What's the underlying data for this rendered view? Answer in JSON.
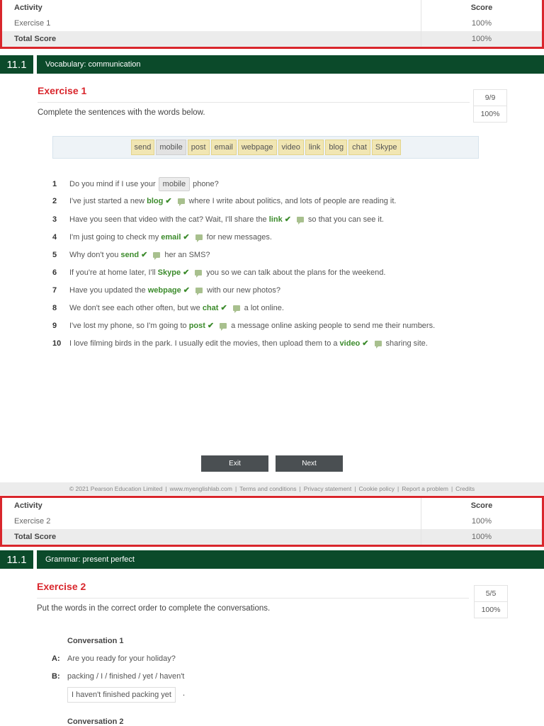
{
  "score_table_1": {
    "col_activity": "Activity",
    "col_score": "Score",
    "row_activity": "Exercise 1",
    "row_score": "100%",
    "total_label": "Total Score",
    "total_score": "100%"
  },
  "unit_1": {
    "number": "11.1",
    "title": "Vocabulary: communication"
  },
  "exercise_1": {
    "title": "Exercise 1",
    "instruction": "Complete the sentences with the words below.",
    "score_fraction": "9/9",
    "score_percent": "100%",
    "wordbank": [
      "send",
      "mobile",
      "post",
      "email",
      "webpage",
      "video",
      "link",
      "blog",
      "chat",
      "Skype"
    ],
    "sentences": [
      {
        "num": "1",
        "before": "Do you mind if I use your",
        "answer": "mobile",
        "after": "phone?"
      },
      {
        "num": "2",
        "before": "I've just started a new",
        "answer": "blog",
        "after": "where I write about politics, and lots of people are reading it."
      },
      {
        "num": "3",
        "before": "Have you seen that video with the cat? Wait, I'll share the",
        "answer": "link",
        "after": "so that you can see it."
      },
      {
        "num": "4",
        "before": "I'm just going to check my",
        "answer": "email",
        "after": "for new messages."
      },
      {
        "num": "5",
        "before": "Why don't you",
        "answer": "send",
        "after": "her an SMS?"
      },
      {
        "num": "6",
        "before": "If you're at home later, I'll",
        "answer": "Skype",
        "after": "you so we can talk about the plans for the weekend."
      },
      {
        "num": "7",
        "before": "Have you updated the",
        "answer": "webpage",
        "after": "with our new photos?"
      },
      {
        "num": "8",
        "before": "We don't see each other often, but we",
        "answer": "chat",
        "after": "a lot online."
      },
      {
        "num": "9",
        "before": "I've lost my phone, so I'm going to",
        "answer": "post",
        "after": "a message online asking people to send me their numbers."
      },
      {
        "num": "10",
        "before": "I love filming birds in the park. I usually edit the movies, then upload them to a",
        "answer": "video",
        "after": "sharing site."
      }
    ],
    "check_mark": "✔",
    "exit_label": "Exit",
    "next_label": "Next"
  },
  "footer": {
    "copyright": "© 2021 Pearson Education Limited",
    "links": [
      "www.myenglishlab.com",
      "Terms and conditions",
      "Privacy statement",
      "Cookie policy",
      "Report a problem",
      "Credits"
    ],
    "separator": "|"
  },
  "score_table_2": {
    "col_activity": "Activity",
    "col_score": "Score",
    "row_activity": "Exercise 2",
    "row_score": "100%",
    "total_label": "Total Score",
    "total_score": "100%"
  },
  "unit_2": {
    "number": "11.1",
    "title": "Grammar: present perfect"
  },
  "exercise_2": {
    "title": "Exercise 2",
    "instruction": "Put the words in the correct order to complete the conversations.",
    "score_fraction": "5/5",
    "score_percent": "100%",
    "conversation_1_title": "Conversation 1",
    "speaker_a": "A:",
    "line_a": "Are you ready for your holiday?",
    "speaker_b": "B:",
    "line_b": "packing / I / finished / yet / haven't",
    "answer": "I haven't finished packing yet",
    "answer_suffix": ".",
    "conversation_2_title": "Conversation 2"
  },
  "colors": {
    "brand_green": "#0b4a2a",
    "accent_red": "#d9262c",
    "correct_green": "#3c8b2c"
  }
}
